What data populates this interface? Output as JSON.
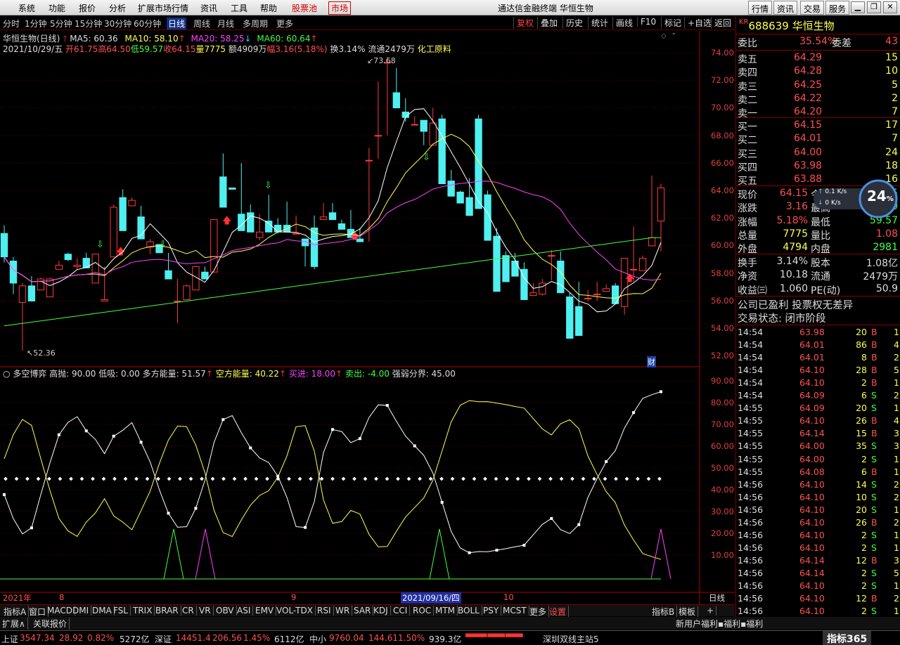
{
  "menu": {
    "items": [
      "系统",
      "功能",
      "报价",
      "分析",
      "扩展市场行情",
      "资讯",
      "工具",
      "帮助"
    ],
    "stock_pool": "股票池",
    "market": "市场",
    "app_title": "通达信金融终端  华恒生物",
    "top_buttons": [
      "行情",
      "资讯",
      "交易",
      "服务"
    ]
  },
  "toolbar": {
    "periods": [
      "分时",
      "1分钟",
      "5分钟",
      "15分钟",
      "30分钟",
      "60分钟",
      "日线",
      "周线",
      "月线",
      "多周期",
      "更多"
    ],
    "active": "日线",
    "right": [
      "复权",
      "叠加",
      "历史",
      "统计",
      "画线",
      "F10",
      "标记",
      "+自选",
      "返回"
    ],
    "right_active": "复权"
  },
  "chart_head": {
    "name": "华恒生物(日线)",
    "ma5": "MA5: 60.36",
    "ma10": "MA10: 58.10",
    "ma20": "MA20: 58.25",
    "ma60": "MA60: 60.64",
    "date": "2021/10/29/五",
    "open": "开61.75",
    "high": "高64.50",
    "low": "低59.57",
    "close": "收64.15",
    "vol": "量7775",
    "amt": "额4909万",
    "chg": "幅3.16(5.18%)",
    "turn": "换3.14%",
    "float": "流通2479万",
    "sector": "化工原料",
    "max_label": "73.68",
    "min_label": "52.36",
    "fin": "财"
  },
  "indicator_head": {
    "name": "多空博弈",
    "high": "高抛: 90.00",
    "low": "低吸: 0.00",
    "bull": "多方能量: 51.57",
    "bear": "空方能量: 40.22",
    "buy": "买进: 18.00",
    "sell": "卖出: -4.00",
    "line": "强弱分界: 45.00"
  },
  "x_labels": {
    "y2021": "2021年",
    "m8": "8",
    "m9": "9",
    "m10": "10",
    "cursor": "2021/09/16/四",
    "right": "日线"
  },
  "price_axis": [
    "74.00",
    "72.00",
    "70.00",
    "68.00",
    "66.00",
    "64.00",
    "62.00",
    "60.00",
    "58.00",
    "56.00",
    "54.00",
    "52.00"
  ],
  "ind_axis": [
    "90.00",
    "80.00",
    "70.00",
    "60.00",
    "50.00",
    "40.00",
    "30.00",
    "20.00",
    "10.00"
  ],
  "stock": {
    "code_prefix": "KR",
    "code": "688639",
    "name": "华恒生物"
  },
  "quote": {
    "wb": {
      "label": "委比",
      "v": "35.54%",
      "l2": "委差",
      "v2": "43"
    },
    "asks": [
      {
        "l": "卖五",
        "p": "64.29",
        "q": "15"
      },
      {
        "l": "卖四",
        "p": "64.28",
        "q": "10"
      },
      {
        "l": "卖三",
        "p": "64.25",
        "q": "5"
      },
      {
        "l": "卖二",
        "p": "64.22",
        "q": "2"
      },
      {
        "l": "卖一",
        "p": "64.20",
        "q": "7"
      }
    ],
    "bids": [
      {
        "l": "买一",
        "p": "64.15",
        "q": "17"
      },
      {
        "l": "买二",
        "p": "64.01",
        "q": "7"
      },
      {
        "l": "买三",
        "p": "64.00",
        "q": "24"
      },
      {
        "l": "买四",
        "p": "63.98",
        "q": "18"
      },
      {
        "l": "买五",
        "p": "63.88",
        "q": "16"
      }
    ],
    "stats": [
      {
        "l": "现价",
        "v": "64.15",
        "l2": "今开",
        "v2": "61.75"
      },
      {
        "l": "涨跌",
        "v": "3.16",
        "l2": "最高",
        "v2": "64.50"
      },
      {
        "l": "涨幅",
        "v": "5.18%",
        "l2": "最低",
        "v2": "59.57"
      },
      {
        "l": "总量",
        "v": "7775",
        "l2": "量比",
        "v2": "1.08"
      },
      {
        "l": "外盘",
        "v": "4794",
        "l2": "内盘",
        "v2": "2981"
      }
    ],
    "stats2": [
      {
        "l": "换手",
        "v": "3.14%",
        "l2": "股本",
        "v2": "1.08亿"
      },
      {
        "l": "净资",
        "v": "10.18",
        "l2": "流通",
        "v2": "2479万"
      },
      {
        "l": "收益㈢",
        "v": "1.060",
        "l2": "PE(动)",
        "v2": "50.9"
      }
    ],
    "note1": "公司已盈利 投票权无差异",
    "note2": "交易状态: 闭市阶段"
  },
  "speed": {
    "pct": "24",
    "unit": "%",
    "up": "0.1",
    "upu": "K/s",
    "down": "0",
    "downu": "K/s"
  },
  "ticks": [
    [
      "14:54",
      "63.98",
      "20",
      "B",
      "1"
    ],
    [
      "14:54",
      "64.01",
      "86",
      "B",
      "4"
    ],
    [
      "14:54",
      "64.01",
      "8",
      "B",
      "2"
    ],
    [
      "14:54",
      "64.10",
      "28",
      "B",
      "5"
    ],
    [
      "14:54",
      "64.10",
      "2",
      "B",
      "1"
    ],
    [
      "14:54",
      "64.09",
      "6",
      "S",
      "2"
    ],
    [
      "14:55",
      "64.09",
      "20",
      "S",
      "1"
    ],
    [
      "14:55",
      "64.10",
      "26",
      "B",
      "4"
    ],
    [
      "14:55",
      "64.14",
      "15",
      "B",
      "3"
    ],
    [
      "14:55",
      "64.00",
      "35",
      "S",
      "3"
    ],
    [
      "14:55",
      "64.00",
      "2",
      "S",
      "1"
    ],
    [
      "14:55",
      "64.08",
      "6",
      "B",
      "1"
    ],
    [
      "14:56",
      "64.10",
      "14",
      "S",
      "2"
    ],
    [
      "14:56",
      "64.10",
      "10",
      "S",
      "2"
    ],
    [
      "14:56",
      "64.10",
      "20",
      "S",
      "1"
    ],
    [
      "14:56",
      "64.10",
      "26",
      "B",
      "2"
    ],
    [
      "14:56",
      "64.10",
      "2",
      "S",
      "1"
    ],
    [
      "14:56",
      "64.10",
      "2",
      "S",
      "1"
    ],
    [
      "14:56",
      "64.14",
      "12",
      "B",
      "3"
    ],
    [
      "14:56",
      "64.14",
      "2",
      "S",
      "5"
    ],
    [
      "14:56",
      "64.10",
      "2",
      "S",
      "1"
    ],
    [
      "14:56",
      "64.10",
      "12",
      "B",
      "2"
    ],
    [
      "14:56",
      "64.10",
      "2",
      "S",
      "1"
    ],
    [
      "14:56",
      "64.10",
      "2",
      "B",
      "2"
    ]
  ],
  "tabs": [
    "指标A",
    "窗口",
    "MACD",
    "DMI",
    "DMA",
    "FSL",
    "TRIX",
    "BRAR",
    "CR",
    "VR",
    "OBV",
    "ASI",
    "EMV",
    "VOL-TDX",
    "RSI",
    "WR",
    "SAR",
    "KDJ",
    "CCI",
    "ROC",
    "MTM",
    "BOLL",
    "PSY",
    "MCST",
    "更多",
    "设置"
  ],
  "tabs_right": [
    "指标B",
    "模板",
    "+"
  ],
  "tabs2": [
    "扩展∧",
    "关联报价"
  ],
  "tabs2_right": "新用户福利▪福利▪福利",
  "status": {
    "sh": "上证",
    "sh_v": "3547.34",
    "sh_c": "28.92",
    "sh_p": "0.82%",
    "sh_a": "5272亿",
    "sz": "深证",
    "sz_v": "14451.4",
    "sz_c": "206.56",
    "sz_p": "1.45%",
    "sz_a": "6112亿",
    "zx": "中小",
    "zx_v": "9760.04",
    "zx_c": "144.61",
    "zx_p": "1.50%",
    "zx_a": "939.3亿",
    "server": "深圳双线主站5",
    "brand": "指标365"
  },
  "chart_data": {
    "type": "candlestick",
    "price_range": [
      52,
      75
    ],
    "ohlc": [
      [
        60.9,
        61.5,
        58.8,
        59.2
      ],
      [
        58.9,
        59.2,
        56.5,
        57.3
      ],
      [
        55.9,
        57.3,
        52.4,
        57.1
      ],
      [
        57.1,
        57.8,
        56.7,
        56.0
      ],
      [
        56.8,
        57.7,
        57.6,
        57.6
      ],
      [
        56.3,
        57.7,
        56.3,
        57.6
      ],
      [
        58.3,
        58.9,
        58.5,
        58.6
      ],
      [
        59.4,
        59.5,
        58.9,
        59.0
      ],
      [
        58.5,
        59.1,
        58.3,
        58.6
      ],
      [
        59.1,
        59.5,
        58.4,
        58.4
      ],
      [
        57.3,
        59.4,
        57.7,
        59.4
      ],
      [
        56.0,
        58.5,
        56.6,
        56.1
      ],
      [
        59.2,
        63.0,
        59.4,
        62.8
      ],
      [
        63.5,
        64.1,
        61.7,
        61.1
      ],
      [
        62.9,
        63.5,
        63.2,
        63.3
      ],
      [
        62.1,
        62.9,
        60.7,
        60.5
      ],
      [
        59.9,
        60.5,
        59.4,
        60.3
      ],
      [
        60.1,
        60.0,
        59.5,
        59.5
      ],
      [
        58.2,
        59.5,
        57.6,
        57.6
      ],
      [
        56.0,
        57.6,
        54.4,
        56.0
      ],
      [
        56.1,
        57.2,
        57.1,
        57.1
      ],
      [
        56.8,
        58.5,
        58.0,
        58.5
      ],
      [
        58.1,
        58.5,
        57.6,
        57.6
      ],
      [
        58.1,
        61.8,
        61.9,
        61.9
      ],
      [
        65.0,
        66.7,
        62.8,
        62.8
      ],
      [
        64.2,
        64.1,
        64.1,
        64.1
      ],
      [
        62.3,
        66.0,
        62.3,
        61.1
      ],
      [
        62.4,
        63.0,
        61.1,
        61.0
      ],
      [
        60.6,
        62.3,
        60.4,
        61.0
      ],
      [
        61.8,
        63.7,
        61.0,
        61.0
      ],
      [
        61.5,
        62.0,
        60.9,
        61.0
      ],
      [
        61.5,
        63.2,
        61.0,
        61.0
      ],
      [
        60.9,
        62.2,
        61.0,
        60.9
      ],
      [
        60.5,
        60.5,
        58.5,
        60.0
      ],
      [
        61.3,
        62.2,
        58.3,
        58.5
      ],
      [
        61.9,
        63.1,
        62.0,
        62.1
      ],
      [
        62.4,
        63.1,
        61.9,
        61.9
      ],
      [
        61.6,
        61.9,
        61.2,
        61.2
      ],
      [
        61.2,
        62.6,
        61.0,
        60.6
      ],
      [
        60.5,
        61.3,
        60.3,
        60.3
      ],
      [
        66.2,
        67.1,
        60.3,
        66.2
      ],
      [
        68.0,
        71.9,
        66.3,
        68.0
      ],
      [
        73.3,
        73.7,
        68.0,
        73.3
      ],
      [
        71.1,
        72.9,
        70.0,
        70.0
      ],
      [
        69.7,
        70.7,
        69.0,
        69.3
      ],
      [
        68.8,
        69.4,
        68.8,
        68.8
      ],
      [
        69.1,
        68.3,
        67.3,
        68.3
      ],
      [
        67.3,
        70.0,
        68.9,
        68.9
      ],
      [
        69.2,
        69.5,
        66.4,
        64.5
      ],
      [
        64.7,
        65.5,
        63.6,
        63.6
      ],
      [
        63.9,
        64.0,
        63.3,
        63.1
      ],
      [
        63.5,
        64.9,
        62.4,
        62.2
      ],
      [
        69.2,
        69.5,
        62.7,
        62.7
      ],
      [
        63.7,
        64.0,
        60.4,
        60.4
      ],
      [
        60.7,
        61.3,
        56.7,
        56.7
      ],
      [
        59.3,
        59.6,
        57.4,
        57.4
      ],
      [
        58.9,
        59.5,
        58.5,
        57.8
      ],
      [
        58.3,
        58.8,
        56.1,
        56.1
      ],
      [
        56.4,
        57.3,
        56.6,
        56.6
      ],
      [
        56.5,
        57.6,
        56.4,
        57.3
      ],
      [
        59.3,
        59.7,
        57.5,
        59.3
      ],
      [
        58.9,
        59.6,
        56.6,
        56.6
      ],
      [
        56.3,
        56.6,
        53.3,
        53.3
      ],
      [
        55.6,
        57.4,
        55.6,
        53.5
      ],
      [
        56.2,
        56.8,
        56.0,
        56.2
      ],
      [
        56.5,
        57.4,
        56.0,
        56.5
      ],
      [
        56.7,
        57.2,
        56.9,
        56.9
      ],
      [
        57.1,
        57.3,
        56.0,
        55.8
      ],
      [
        55.6,
        59.1,
        55.0,
        59.1
      ],
      [
        58.3,
        61.4,
        57.4,
        58.3
      ],
      [
        58.2,
        59.3,
        58.5,
        59.1
      ],
      [
        60.0,
        65.1,
        60.7,
        60.6
      ],
      [
        61.8,
        64.5,
        59.6,
        64.2
      ]
    ],
    "ma5_color": "#ffffff",
    "ma10_color": "#ffff50",
    "ma20_color": "#ff40ff",
    "ma60_color": "#40ff40"
  }
}
